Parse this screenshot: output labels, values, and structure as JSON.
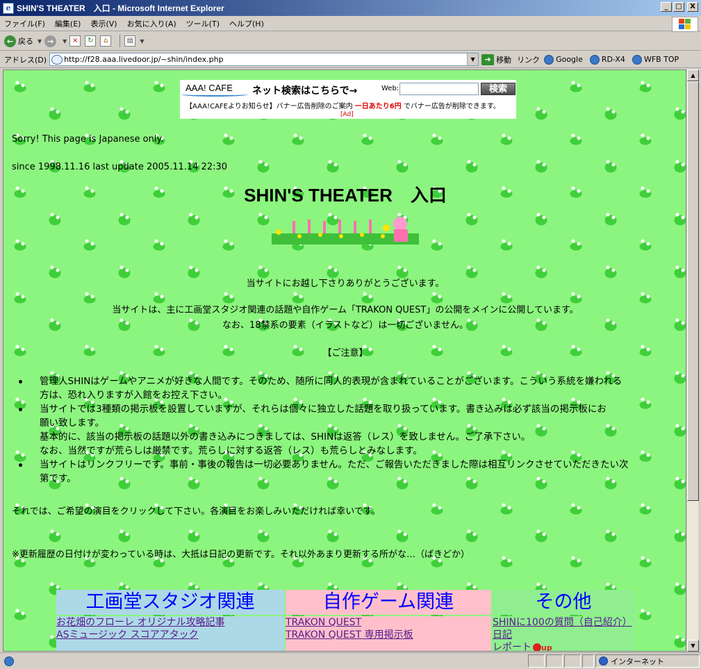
{
  "window": {
    "title": "SHIN'S THEATER　入口 - Microsoft Internet Explorer",
    "app_icon": "e",
    "buttons": {
      "minimize": "_",
      "maximize": "□",
      "close": "X"
    }
  },
  "menu": [
    "ファイル(F)",
    "編集(E)",
    "表示(V)",
    "お気に入り(A)",
    "ツール(T)",
    "ヘルプ(H)"
  ],
  "toolbar": {
    "back_label": "戻る",
    "back_icon": "←",
    "forward_icon": "→"
  },
  "address": {
    "label": "アドレス(D)",
    "url": "http://f28.aaa.livedoor.jp/~shin/index.php",
    "go_label": "移動",
    "links_label": "リンク",
    "links": [
      "Google",
      "RD-X4",
      "WFB TOP"
    ]
  },
  "status": {
    "zone": "インターネット"
  },
  "ad": {
    "logo": "AAA! CAFE",
    "search_label": "ネット検索はこちらで→",
    "web_label": "Web:",
    "button": "検索",
    "notice_prefix": "【AAA!CAFEよりお知らせ】バナー広告削除のご案内",
    "notice_red": "一日あたり6円",
    "notice_suffix": "でバナー広告が削除できます。",
    "ad_tag": "[Ad]"
  },
  "page": {
    "sorry": "Sorry! This page is Japanese only.",
    "since": "since 1998.11.16 last update 2005.11.14 22:30",
    "title": "SHIN'S THEATER　入口",
    "welcome": "当サイトにお越し下さりありがとうございます。",
    "intro1": "当サイトは、主に工画堂スタジオ関連の話題や自作ゲーム「TRAKON QUEST」の公開をメインに公開しています。",
    "intro2": "なお、18禁系の要素（イラストなど）は一切ございません。",
    "caution_heading": "【ご注意】",
    "notices": [
      {
        "lines": [
          "管理人SHINはゲームやアニメが好きな人間です。そのため、随所に同人的表現が含まれていることがございます。こういう系統を嫌われる",
          "方は、恐れ入りますが入館をお控え下さい。"
        ]
      },
      {
        "lines": [
          "当サイトでは3種類の掲示板を設置していますが、それらは個々に独立した話題を取り扱っています。書き込みは必ず該当の掲示板にお",
          "願い致します。",
          "基本的に、該当の掲示板の話題以外の書き込みにつきましては、SHINは返答（レス）を致しません。ご了承下さい。",
          "なお、当然ですが荒らしは厳禁です。荒らしに対する返答（レス）も荒らしとみなします。"
        ]
      },
      {
        "lines": [
          "当サイトはリンクフリーです。事前・事後の報告は一切必要ありません。ただ、ご報告いただきました際は相互リンクさせていただきたい次",
          "第です。"
        ]
      }
    ],
    "choose": "それでは、ご希望の演目をクリックして下さい。各演目をお楽しみいただければ幸いです。",
    "note": "※更新履歴の日付けが変わっている時は、大抵は日記の更新です。それ以外あまり更新する所がな…（ばきどか）"
  },
  "menu_table": {
    "columns": [
      {
        "header": "工画堂スタジオ関連",
        "bg": "#add8e6",
        "links": [
          "お花畑のフローレ オリジナル攻略記事",
          "",
          "ASミュージック スコアアタック"
        ]
      },
      {
        "header": "自作ゲーム関連",
        "bg": "#ffc0cb",
        "links": [
          "TRAKON QUEST",
          "TRAKON QUEST 専用掲示板"
        ]
      },
      {
        "header": "その他",
        "bg": "#90ee90",
        "links": [
          "SHINに100の質問（自己紹介）",
          "日記",
          "レポート"
        ]
      }
    ],
    "up_label": "up"
  },
  "colors": {
    "page_bg": "#8cf57f",
    "link": "#0000ee",
    "visited": "#551a8b",
    "header_text": "#0000ff"
  }
}
